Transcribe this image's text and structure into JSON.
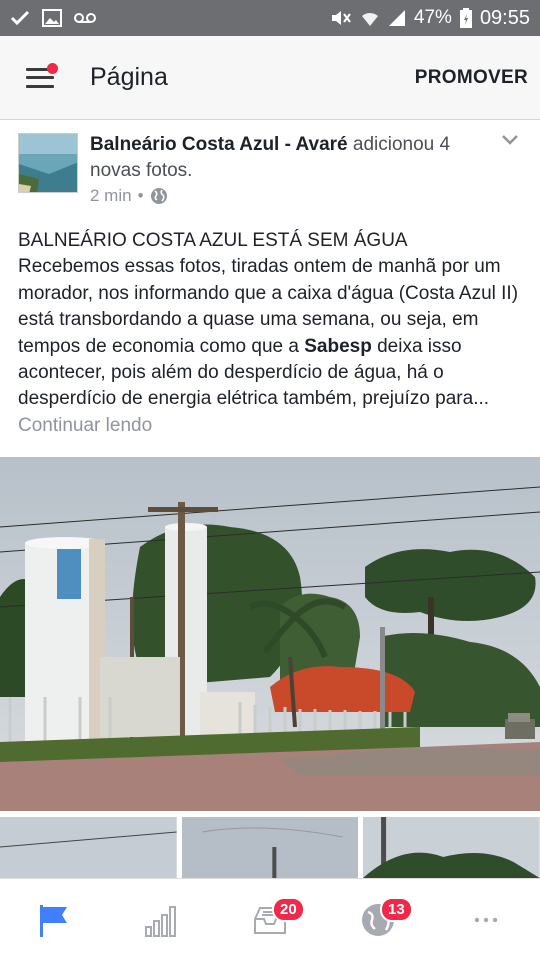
{
  "status_bar": {
    "battery_percent": "47%",
    "time": "09:55"
  },
  "header": {
    "title": "Página",
    "promote_label": "PROMOVER"
  },
  "post": {
    "author": "Balneário Costa Azul - Avaré",
    "action": "adicionou",
    "action_detail": "4 novas fotos.",
    "timestamp": "2 min",
    "meta_separator": "•",
    "text_heading": "BALNEÁRIO COSTA AZUL ESTÁ SEM ÁGUA",
    "text_part1": "Recebemos essas fotos, tiradas ontem de manhã por um morador, nos informando que a caixa d'água (Costa Azul II) está transbordando a quase uma semana, ou seja, em tempos de economia como que a ",
    "text_bold": "Sabesp",
    "text_part2": " deixa isso acontecer, pois além do desperdício de água, há o desperdício de energia elétrica também, prejuízo para...",
    "continue_label": "Continuar lendo"
  },
  "bottom_nav": {
    "items": [
      {
        "name": "page",
        "icon": "flag-icon",
        "active": true
      },
      {
        "name": "insights",
        "icon": "bar-chart-icon"
      },
      {
        "name": "messages",
        "icon": "inbox-icon",
        "badge": "20"
      },
      {
        "name": "notifications",
        "icon": "globe-icon",
        "badge": "13"
      },
      {
        "name": "more",
        "icon": "more-icon"
      }
    ]
  },
  "colors": {
    "accent": "#4080ff",
    "badge": "#f02849",
    "status_bar": "#6d6e71"
  }
}
